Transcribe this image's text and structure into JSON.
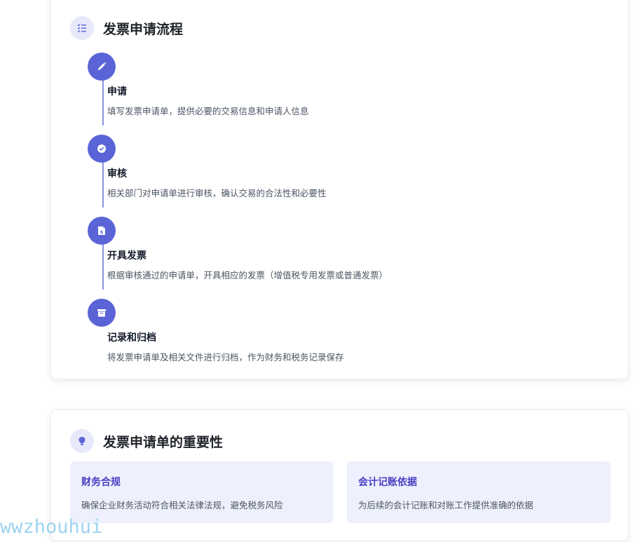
{
  "process": {
    "title": "发票申请流程",
    "icon": "checklist-icon",
    "steps": [
      {
        "title": "申请",
        "desc": "填写发票申请单，提供必要的交易信息和申请人信息",
        "icon": "pencil-icon"
      },
      {
        "title": "审核",
        "desc": "相关部门对申请单进行审核，确认交易的合法性和必要性",
        "icon": "check-circle-icon"
      },
      {
        "title": "开具发票",
        "desc": "根据审核通过的申请单，开具相应的发票（增值税专用发票或普通发票）",
        "icon": "invoice-icon"
      },
      {
        "title": "记录和归档",
        "desc": "将发票申请单及相关文件进行归档，作为财务和税务记录保存",
        "icon": "archive-icon"
      }
    ]
  },
  "importance": {
    "title": "发票申请单的重要性",
    "icon": "lightbulb-icon",
    "items": [
      {
        "title": "财务合规",
        "desc": "确保企业财务活动符合相关法律法规，避免税务风险"
      },
      {
        "title": "会计记账依据",
        "desc": "为后续的会计记账和对账工作提供准确的依据"
      }
    ]
  },
  "watermark": "wwzhouhui",
  "colors": {
    "accent": "#5b64d6",
    "accent_light": "#e7e9fb",
    "box_bg": "#eef1fd",
    "box_title": "#4a3fc4",
    "watermark": "#9ed3f0"
  }
}
